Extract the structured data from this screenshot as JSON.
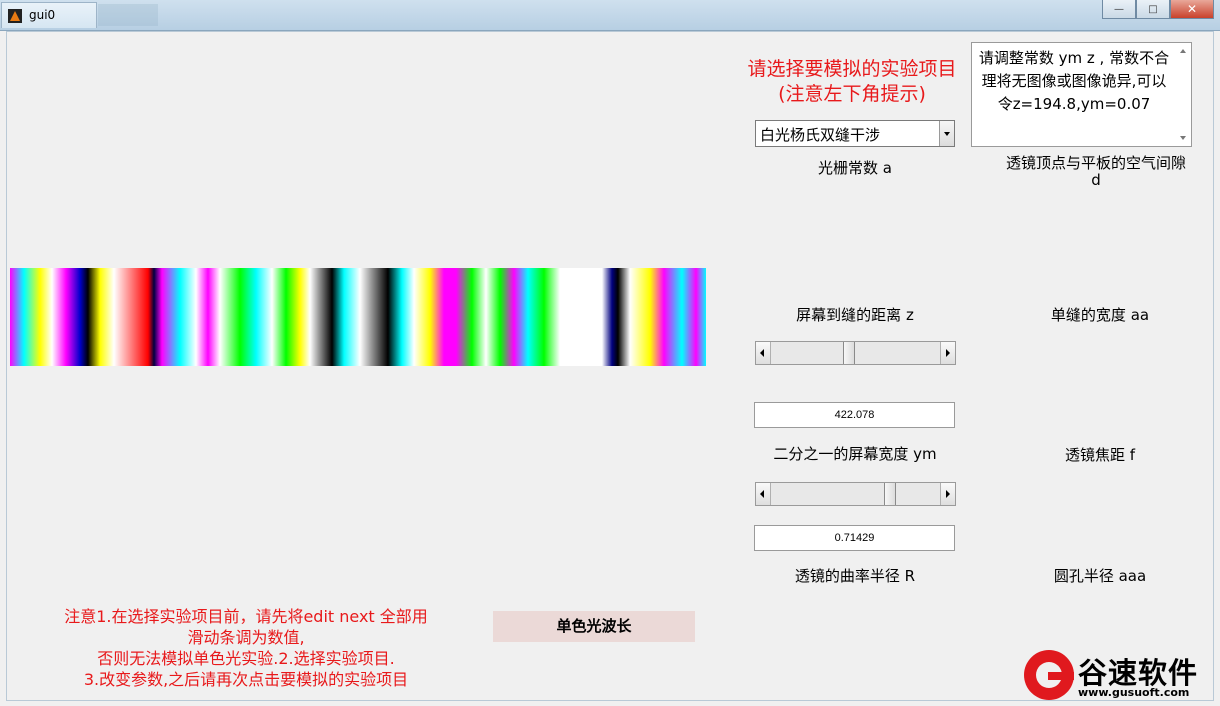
{
  "window": {
    "title": "gui0",
    "buttons": {
      "minimize": "—",
      "maximize": "□",
      "close": "✕"
    }
  },
  "prompt": {
    "line1": "请选择要模拟的实验项目",
    "line2": "(注意左下角提示)"
  },
  "experiment_select": {
    "selected": "白光杨氏双缝干涉"
  },
  "hint_box": {
    "line1": "请调整常数 ym z , 常数不合",
    "line2": "理将无图像或图像诡异,可以",
    "line3": "令z=194.8,ym=0.07"
  },
  "labels": {
    "grating_constant": "光栅常数 a",
    "air_gap": "透镜顶点与平板的空气间隙",
    "air_gap_var": "d",
    "screen_distance": "屏幕到缝的距离 z",
    "single_slit_width": "单缝的宽度  aa",
    "half_screen_width": "二分之一的屏幕宽度 ym",
    "focal_length": "透镜焦距   f",
    "curvature_radius": "透镜的曲率半径 R",
    "hole_radius": "圆孔半径  aaa"
  },
  "sliders": {
    "z": {
      "fraction": 0.46
    },
    "ym": {
      "fraction": 0.72
    }
  },
  "edits": {
    "z_value": "422.078",
    "ym_value": "0.71429"
  },
  "notice": {
    "line1": "注意1.在选择实验项目前，请先将edit next 全部用",
    "line2": "滑动条调为数值,",
    "line3": "否则无法模拟单色光实验.2.选择实验项目.",
    "line4": "3.改变参数,之后请再次点击要模拟的实验项目"
  },
  "buttons": {
    "monochrome": "单色光波长"
  },
  "watermark": {
    "name": "谷速软件",
    "url": "www.gusuoft.com"
  },
  "colors": {
    "accent_red": "#e8191b",
    "button_pink": "#ebd9d7"
  }
}
